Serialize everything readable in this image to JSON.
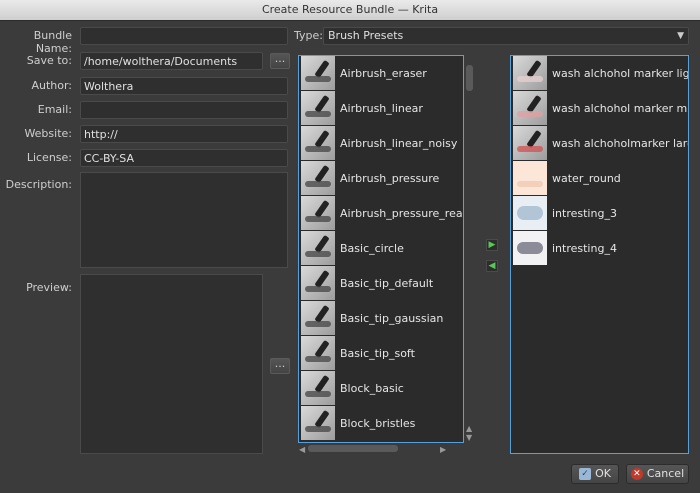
{
  "window": {
    "title": "Create Resource Bundle — Krita"
  },
  "form": {
    "bundle_name_label": "Bundle Name:",
    "bundle_name_value": "",
    "save_to_label": "Save to:",
    "save_to_value": "/home/wolthera/Documents",
    "author_label": "Author:",
    "author_value": "Wolthera",
    "email_label": "Email:",
    "email_value": "",
    "website_label": "Website:",
    "website_value": "http://",
    "license_label": "License:",
    "license_value": "CC-BY-SA",
    "description_label": "Description:",
    "preview_label": "Preview:",
    "browse_label": "...",
    "preview_browse_label": "..."
  },
  "type": {
    "label": "Type:",
    "selected": "Brush Presets",
    "arrow_icon": "chevron-down-icon"
  },
  "available": {
    "items": [
      {
        "label": "Airbrush_eraser"
      },
      {
        "label": "Airbrush_linear"
      },
      {
        "label": "Airbrush_linear_noisy"
      },
      {
        "label": "Airbrush_pressure"
      },
      {
        "label": "Airbrush_pressure_realistic"
      },
      {
        "label": "Basic_circle"
      },
      {
        "label": "Basic_tip_default"
      },
      {
        "label": "Basic_tip_gaussian"
      },
      {
        "label": "Basic_tip_soft"
      },
      {
        "label": "Block_basic"
      },
      {
        "label": "Block_bristles"
      }
    ]
  },
  "selected": {
    "items": [
      {
        "label": "wash alchohol marker light"
      },
      {
        "label": "wash alchohol marker mid"
      },
      {
        "label": "wash alchoholmarker large"
      },
      {
        "label": "water_round"
      },
      {
        "label": "intresting_3"
      },
      {
        "label": "intresting_4"
      }
    ]
  },
  "buttons": {
    "ok": "OK",
    "cancel": "Cancel"
  },
  "colors": {
    "accent": "#5aa0d8",
    "move_arrow": "#55c855",
    "cancel_icon": "#c0392b"
  }
}
